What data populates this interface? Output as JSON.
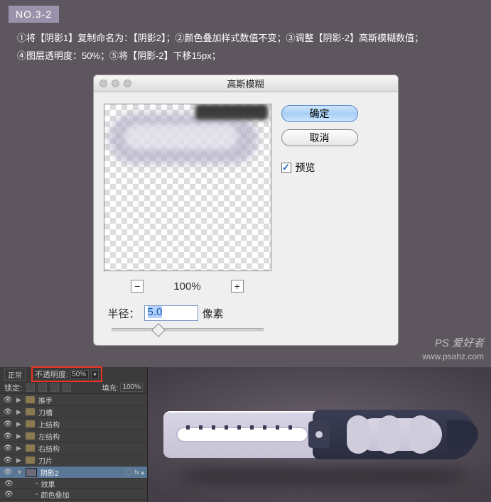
{
  "step_badge": "NO.3-2",
  "instruction_line1": "①将【阴影1】复制命名为：【阴影2】；②颜色叠加样式数值不变；③调整【阴影-2】高斯模糊数值；",
  "instruction_line2": "④图层透明度：50%；⑤将【阴影-2】下移15px；",
  "dialog": {
    "title": "高斯模糊",
    "ok": "确定",
    "cancel": "取消",
    "preview_label": "预览",
    "zoom": "100%",
    "radius_label": "半径：",
    "radius_value": "5.0",
    "radius_unit": "像素"
  },
  "layers_panel": {
    "blend_mode": "正常",
    "opacity_label": "不透明度:",
    "opacity_value": "50%",
    "lock_label": "锁定:",
    "fill_label": "填充:",
    "fill_value": "100%",
    "items": [
      {
        "name": "推手",
        "type": "folder"
      },
      {
        "name": "刀槽",
        "type": "folder"
      },
      {
        "name": "上结构",
        "type": "folder"
      },
      {
        "name": "左结构",
        "type": "folder"
      },
      {
        "name": "右结构",
        "type": "folder"
      },
      {
        "name": "刀片",
        "type": "folder"
      },
      {
        "name": "阴影2",
        "type": "layer",
        "active": true,
        "fx": "fx"
      },
      {
        "name": "效果",
        "type": "sub"
      },
      {
        "name": "颜色叠加",
        "type": "sub"
      }
    ]
  },
  "watermark": {
    "line1": "PS 爱好者",
    "line2": "www.psahz.com"
  }
}
